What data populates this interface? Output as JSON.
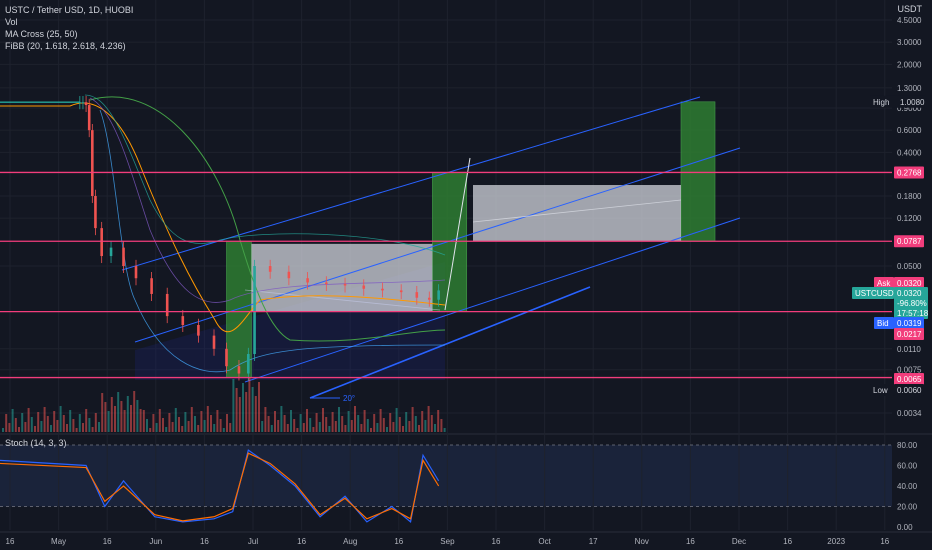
{
  "legend": {
    "symbol": "USTC / Tether USD, 1D, HUOBI",
    "vol": "Vol",
    "ma_cross": "MA Cross (25, 50)",
    "fibb": "FiBB (20, 1.618, 2.618, 4.236)",
    "stoch": "Stoch (14, 3, 3)"
  },
  "price_axis": {
    "currency": "USDT",
    "ticks": [
      "4.5000",
      "3.0000",
      "2.0000",
      "1.3000",
      "0.9000",
      "0.6000",
      "0.4000",
      "0.1800",
      "0.1200",
      "0.0500",
      "0.0110",
      "0.0075",
      "0.0034"
    ]
  },
  "stoch_axis": {
    "ticks": [
      "80.00",
      "60.00",
      "40.00",
      "20.00",
      "0.00"
    ]
  },
  "time_axis": {
    "ticks": [
      "16",
      "May",
      "16",
      "Jun",
      "16",
      "Jul",
      "16",
      "Aug",
      "16",
      "Sep",
      "16",
      "Oct",
      "17",
      "Nov",
      "16",
      "Dec",
      "16",
      "2023",
      "16"
    ]
  },
  "tags": {
    "high_label": "High",
    "high_value": "1.0080",
    "level_1": "0.2768",
    "level_2": "0.0787",
    "ask_label": "Ask",
    "ask_value": "0.0320",
    "ticker": "USTCUSDT",
    "last": "0.0320",
    "change": "-96.80%",
    "countdown": "17:57:18",
    "bid_label": "Bid",
    "bid_value": "0.0319",
    "level_3": "0.0217",
    "level_4": "0.0065",
    "low_label": "Low",
    "low_value": "0.0060"
  },
  "annotation": {
    "angle": "20°"
  },
  "colors": {
    "background": "#131722",
    "hline": "#f23d7c",
    "channel": "#2962ff",
    "bull_box": "#2e7d32",
    "range_box": "#d1d4dc",
    "candle_up": "#26a69a",
    "candle_down": "#ef5350",
    "stoch_k": "#2962ff",
    "stoch_d": "#ff6d00"
  },
  "chart_data": [
    {
      "type": "candlestick",
      "title": "USTC / Tether USD, 1D, HUOBI",
      "y_scale": "log",
      "ylim": [
        0.0034,
        4.5
      ],
      "x": [
        "May 6",
        "May 8",
        "May 9",
        "May 10",
        "May 11",
        "May 12",
        "May 13",
        "May 15",
        "May 18",
        "May 22",
        "May 26",
        "May 31",
        "Jun 5",
        "Jun 10",
        "Jun 15",
        "Jun 20",
        "Jun 24",
        "Jun 28",
        "Jul 1",
        "Jul 3",
        "Jul 8",
        "Jul 14",
        "Jul 20",
        "Jul 26",
        "Aug 1",
        "Aug 7",
        "Aug 13",
        "Aug 19",
        "Aug 24",
        "Aug 28",
        "Aug 31"
      ],
      "close": [
        1.0,
        1.0,
        1.0,
        0.95,
        0.6,
        0.18,
        0.1,
        0.06,
        0.07,
        0.05,
        0.04,
        0.03,
        0.02,
        0.017,
        0.014,
        0.011,
        0.008,
        0.007,
        0.01,
        0.05,
        0.045,
        0.04,
        0.037,
        0.036,
        0.035,
        0.033,
        0.032,
        0.031,
        0.028,
        0.027,
        0.032
      ],
      "hlines": [
        0.2768,
        0.0787,
        0.0217,
        0.0065
      ],
      "high": 1.008,
      "low": 0.006,
      "last": 0.032,
      "change_pct": -96.8
    },
    {
      "type": "line",
      "title": "Stoch (14, 3, 3)",
      "ylim": [
        0,
        80
      ],
      "bands": [
        20,
        80
      ],
      "x": [
        "May 1",
        "May 10",
        "May 16",
        "May 22",
        "Jun 1",
        "Jun 10",
        "Jun 20",
        "Jun 26",
        "Jul 1",
        "Jul 8",
        "Jul 16",
        "Jul 24",
        "Aug 1",
        "Aug 8",
        "Aug 16",
        "Aug 22",
        "Aug 26",
        "Aug 31"
      ],
      "series": [
        {
          "values": [
            65,
            60,
            20,
            45,
            10,
            5,
            8,
            15,
            75,
            60,
            40,
            10,
            30,
            5,
            20,
            5,
            70,
            45
          ]
        },
        {
          "values": [
            62,
            58,
            25,
            40,
            12,
            6,
            10,
            18,
            72,
            62,
            42,
            12,
            28,
            8,
            18,
            8,
            65,
            40
          ]
        }
      ]
    }
  ]
}
